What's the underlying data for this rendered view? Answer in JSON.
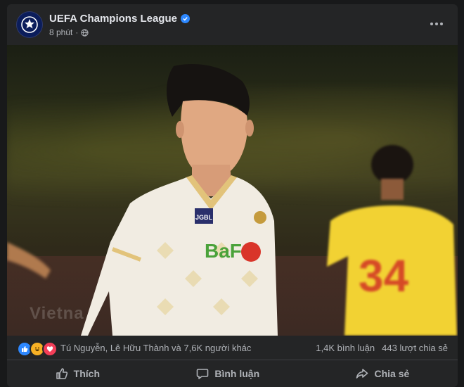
{
  "post": {
    "page_name": "UEFA Champions League",
    "time": "8 phút",
    "watermark": "Vietna",
    "icons": {
      "avatar": "champions-league-starball-icon",
      "verified": "verified-badge-icon",
      "privacy": "globe-icon",
      "more": "more-options-icon"
    }
  },
  "photo": {
    "player_sponsor": "BaF",
    "badge": "JGBL",
    "background_number": "34"
  },
  "stats": {
    "reactors": "Tú Nguyễn, Lê Hữu Thành và 7,6K người khác",
    "comments": "1,4K bình luận",
    "shares": "443 lượt chia sẻ",
    "reaction_icons": [
      "like-icon",
      "haha-icon",
      "love-icon"
    ]
  },
  "actions": {
    "like": "Thích",
    "comment": "Bình luận",
    "share": "Chia sẻ"
  },
  "colors": {
    "background": "#18191a",
    "card": "#242526",
    "text_primary": "#e4e6eb",
    "text_secondary": "#b0b3b8",
    "accent": "#2d88ff"
  }
}
